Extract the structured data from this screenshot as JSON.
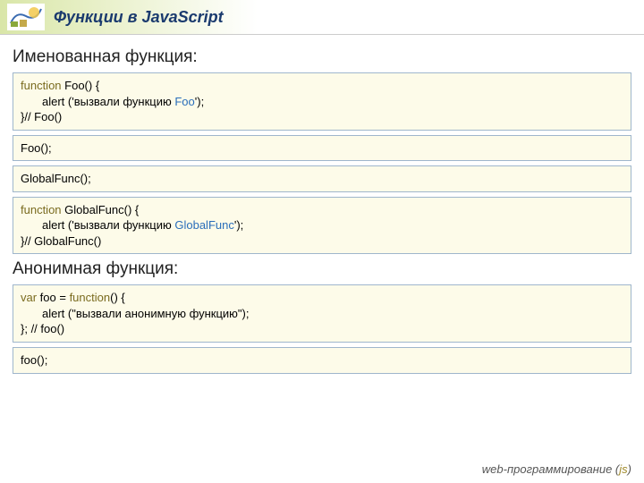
{
  "header": {
    "title": "Функции в JavaScript"
  },
  "sections": {
    "named": {
      "heading": "Именованная функция:",
      "box1_l1_a": "function",
      "box1_l1_b": " Foo() {",
      "box1_l2_a": "alert ('вызвали функцию ",
      "box1_l2_b": "Foo",
      "box1_l2_c": "');",
      "box1_l3": "}// Foo()",
      "box2": "Foo();",
      "box3": "GlobalFunc();",
      "box4_l1_a": "function",
      "box4_l1_b": " GlobalFunc() {",
      "box4_l2_a": "alert ('вызвали функцию ",
      "box4_l2_b": "GlobalFunc",
      "box4_l2_c": "');",
      "box4_l3": "}// GlobalFunc()"
    },
    "anon": {
      "heading": "Анонимная функция:",
      "box1_l1_a": "var ",
      "box1_l1_b": "foo = ",
      "box1_l1_c": "function",
      "box1_l1_d": "() {",
      "box1_l2": "alert (\"вызвали анонимную функцию\");",
      "box1_l3": "}; // foo()",
      "box2": "foo();"
    }
  },
  "footer": {
    "text": "web-программирование ",
    "paren_open": "(",
    "js": "js",
    "paren_close": ")"
  }
}
